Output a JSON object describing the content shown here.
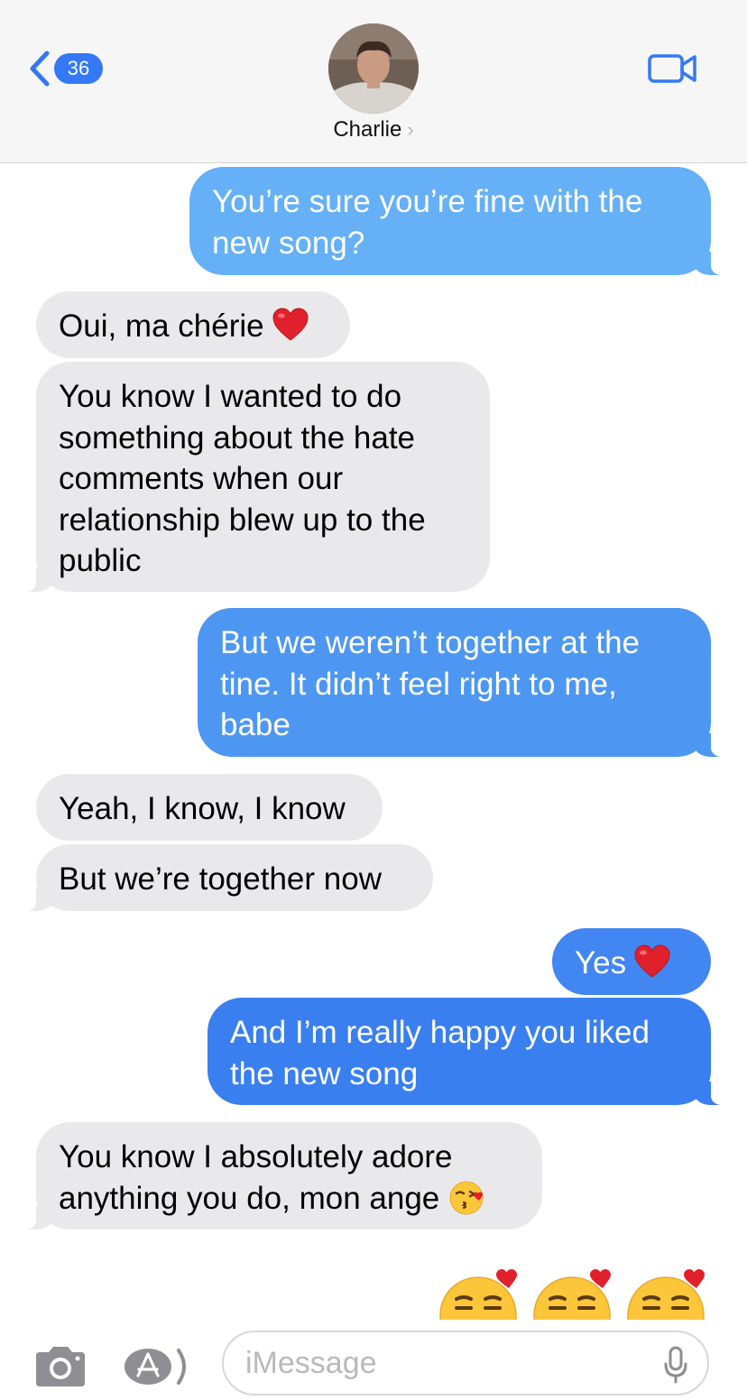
{
  "header": {
    "unread_count": "36",
    "contact_name": "Charlie",
    "contact_chevron": "›",
    "back_icon": "chevron-left-icon",
    "video_icon": "video-camera-icon"
  },
  "colors": {
    "outgoing_top": "#65b0f6",
    "outgoing_mid": "#4d97f2",
    "outgoing_bottom": "#3a7ff0",
    "incoming": "#e9e9eb",
    "accent": "#3478f6"
  },
  "messages": [
    {
      "side": "out",
      "lines": [
        "You’re sure you’re fine with the",
        "new song?"
      ]
    },
    {
      "side": "in",
      "lines": [
        "Oui, ma chérie"
      ],
      "emoji": "red-heart-icon"
    },
    {
      "side": "in",
      "lines": [
        "You know I wanted to do",
        "something about the hate",
        "comments when our",
        "relationship blew up to the",
        "public"
      ]
    },
    {
      "side": "out",
      "lines": [
        "But we weren’t together at the",
        "tine. It didn’t feel right to me,",
        "babe"
      ]
    },
    {
      "side": "in",
      "lines": [
        "Yeah, I know, I know"
      ]
    },
    {
      "side": "in",
      "lines": [
        "But we’re together now"
      ]
    },
    {
      "side": "out",
      "lines": [
        "Yes"
      ],
      "emoji": "red-heart-icon"
    },
    {
      "side": "out",
      "lines": [
        "And I’m really happy you liked",
        "the new song"
      ]
    },
    {
      "side": "in",
      "lines": [
        "You know I absolutely adore",
        "anything you do, mon ange"
      ],
      "emoji": "kissing-face-icon"
    }
  ],
  "typing_emojis": [
    "smiling-face-with-hearts-icon",
    "smiling-face-with-hearts-icon",
    "smiling-face-with-hearts-icon"
  ],
  "composer": {
    "placeholder": "iMessage",
    "camera_icon": "camera-icon",
    "apps_icon": "app-store-icon",
    "mic_icon": "microphone-icon"
  }
}
